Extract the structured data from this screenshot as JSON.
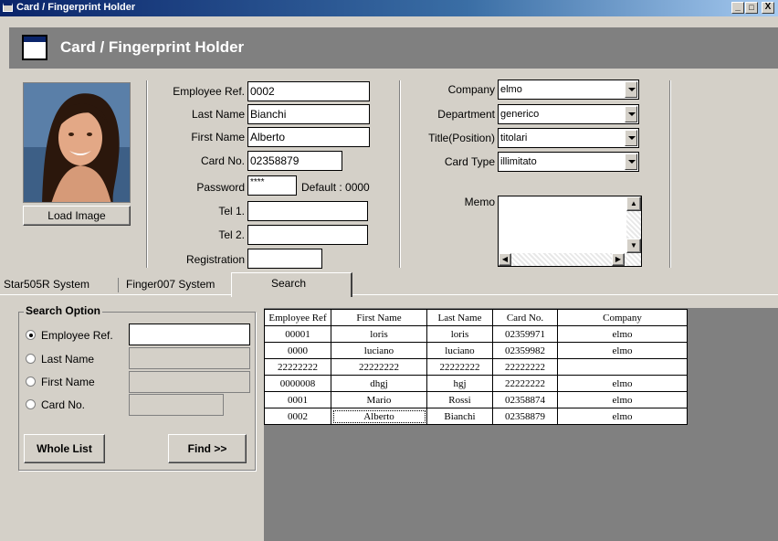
{
  "window": {
    "title": "Card / Fingerprint Holder",
    "controls": [
      "_",
      "□",
      "X"
    ]
  },
  "header": {
    "title": "Card / Fingerprint Holder"
  },
  "photo": {
    "load_label": "Load Image"
  },
  "fields": {
    "employee_ref": {
      "label": "Employee Ref.",
      "value": "0002"
    },
    "last_name": {
      "label": "Last Name",
      "value": "Bianchi"
    },
    "first_name": {
      "label": "First Name",
      "value": "Alberto"
    },
    "card_no": {
      "label": "Card No.",
      "value": "02358879"
    },
    "password": {
      "label": "Password",
      "value": "****",
      "default_text": "Default : 0000"
    },
    "tel1": {
      "label": "Tel 1.",
      "value": ""
    },
    "tel2": {
      "label": "Tel 2.",
      "value": ""
    },
    "registration": {
      "label": "Registration",
      "value": ""
    }
  },
  "right_fields": {
    "company": {
      "label": "Company",
      "value": "elmo"
    },
    "department": {
      "label": "Department",
      "value": "generico"
    },
    "title_position": {
      "label": "Title(Position)",
      "value": "titolari"
    },
    "card_type": {
      "label": "Card Type",
      "value": "illimitato"
    },
    "memo": {
      "label": "Memo",
      "value": ""
    }
  },
  "tabs": [
    "Star505R System",
    "Finger007 System",
    "Search"
  ],
  "search": {
    "group_label": "Search Option",
    "options": [
      "Employee Ref.",
      "Last Name",
      "First Name",
      "Card No."
    ],
    "selected": "Employee Ref.",
    "whole_list_label": "Whole List",
    "find_label": "Find >>"
  },
  "table": {
    "columns": [
      "Employee Ref",
      "First Name",
      "Last Name",
      "Card No.",
      "Company"
    ],
    "rows": [
      [
        "00001",
        "loris",
        "loris",
        "02359971",
        "elmo"
      ],
      [
        "0000",
        "luciano",
        "luciano",
        "02359982",
        "elmo"
      ],
      [
        "22222222",
        "22222222",
        "22222222",
        "22222222",
        ""
      ],
      [
        "0000008",
        "dhgj",
        "hgj",
        "22222222",
        "elmo"
      ],
      [
        "0001",
        "Mario",
        "Rossi",
        "02358874",
        "elmo"
      ],
      [
        "0002",
        "Alberto",
        "Bianchi",
        "02358879",
        "elmo"
      ]
    ]
  },
  "colors": {
    "titlebar": "#0a246a",
    "header_band": "#808080",
    "window_bg": "#d4d0c8",
    "grid_bg": "#808080"
  }
}
